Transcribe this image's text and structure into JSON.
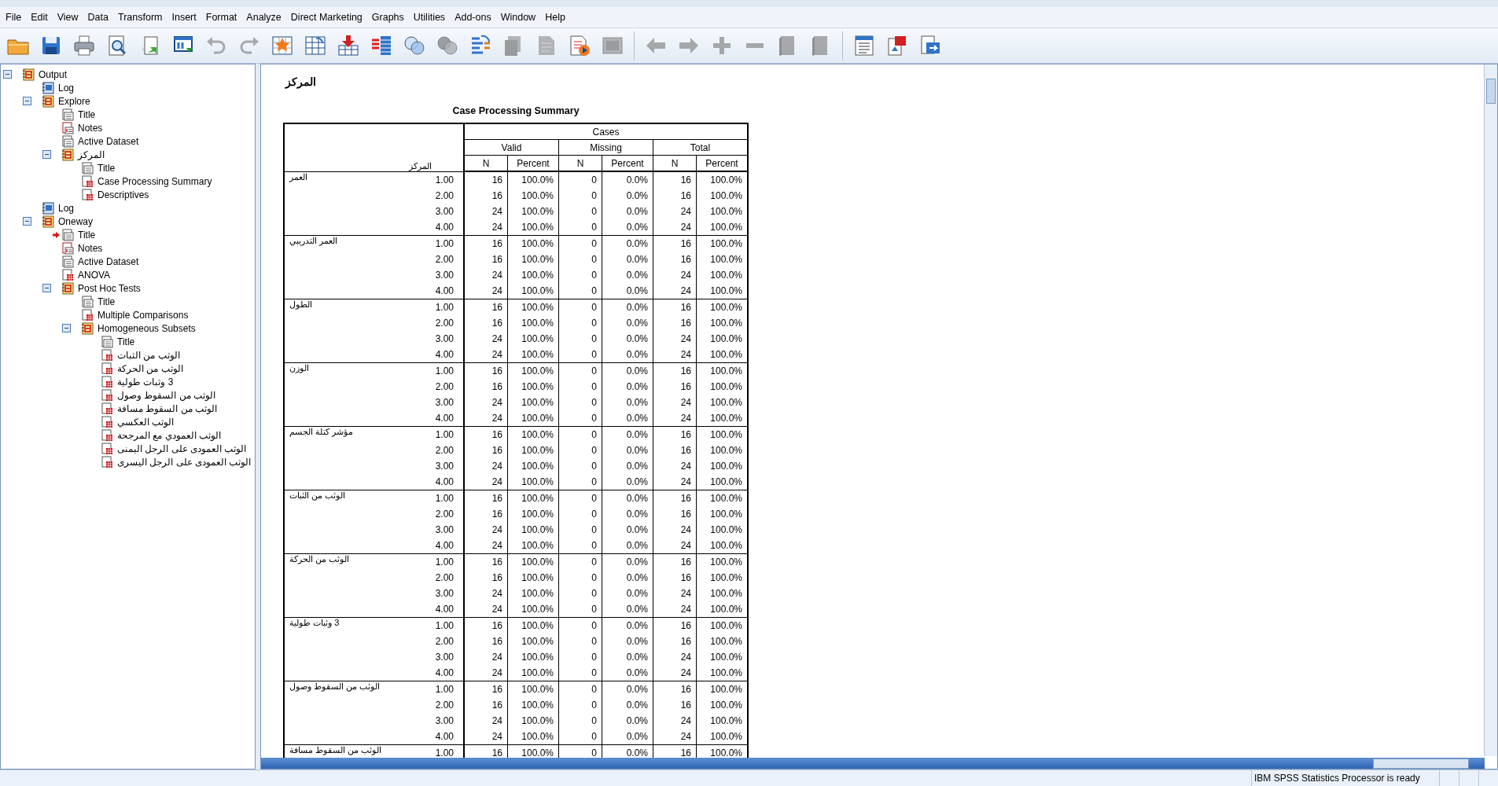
{
  "menu": [
    "File",
    "Edit",
    "View",
    "Data",
    "Transform",
    "Insert",
    "Format",
    "Analyze",
    "Direct Marketing",
    "Graphs",
    "Utilities",
    "Add-ons",
    "Window",
    "Help"
  ],
  "toolbar": [
    {
      "kind": "folder",
      "disabled": false
    },
    {
      "kind": "disk",
      "disabled": false
    },
    {
      "kind": "printer",
      "disabled": false
    },
    {
      "kind": "preview",
      "disabled": false
    },
    {
      "kind": "export",
      "disabled": false
    },
    {
      "kind": "window",
      "disabled": false
    },
    {
      "kind": "undo",
      "disabled": true
    },
    {
      "kind": "redo",
      "disabled": true
    },
    {
      "kind": "star-grid",
      "disabled": false
    },
    {
      "kind": "grid",
      "disabled": false
    },
    {
      "kind": "download",
      "disabled": false
    },
    {
      "kind": "bars",
      "disabled": false
    },
    {
      "kind": "circles",
      "disabled": false
    },
    {
      "kind": "circles",
      "disabled": true
    },
    {
      "kind": "list",
      "disabled": false
    },
    {
      "kind": "docs",
      "disabled": true
    },
    {
      "kind": "doc",
      "disabled": true
    },
    {
      "kind": "doc-play",
      "disabled": false
    },
    {
      "kind": "frame",
      "disabled": true
    },
    {
      "kind": "left",
      "disabled": true
    },
    {
      "kind": "right",
      "disabled": true
    },
    {
      "kind": "plus",
      "disabled": true
    },
    {
      "kind": "minus",
      "disabled": true
    },
    {
      "kind": "book",
      "disabled": true
    },
    {
      "kind": "book",
      "disabled": true
    },
    {
      "kind": "doc-lines",
      "disabled": false
    },
    {
      "kind": "doc-red",
      "disabled": false
    },
    {
      "kind": "doc-blue",
      "disabled": false
    }
  ],
  "tree": [
    {
      "label": "Output",
      "kind": "navigator",
      "expanded": true,
      "current": false,
      "children": [
        {
          "label": "Log",
          "kind": "log",
          "current": false
        },
        {
          "label": "Explore",
          "kind": "navigator",
          "expanded": true,
          "current": false,
          "children": [
            {
              "label": "Title",
              "kind": "title",
              "current": false
            },
            {
              "label": "Notes",
              "kind": "notes",
              "current": false
            },
            {
              "label": "Active Dataset",
              "kind": "dataset",
              "current": false
            },
            {
              "label": "المركز",
              "kind": "navigator",
              "expanded": true,
              "current": false,
              "children": [
                {
                  "label": "Title",
                  "kind": "title",
                  "current": false
                },
                {
                  "label": "Case Processing Summary",
                  "kind": "table",
                  "current": false
                },
                {
                  "label": "Descriptives",
                  "kind": "table",
                  "current": false
                }
              ]
            }
          ]
        },
        {
          "label": "Log",
          "kind": "log",
          "current": false
        },
        {
          "label": "Oneway",
          "kind": "navigator",
          "expanded": true,
          "current": false,
          "children": [
            {
              "label": "Title",
              "kind": "title",
              "current": true
            },
            {
              "label": "Notes",
              "kind": "notes",
              "current": false
            },
            {
              "label": "Active Dataset",
              "kind": "dataset",
              "current": false
            },
            {
              "label": "ANOVA",
              "kind": "table",
              "current": false
            },
            {
              "label": "Post Hoc Tests",
              "kind": "navigator",
              "expanded": true,
              "current": false,
              "children": [
                {
                  "label": "Title",
                  "kind": "title",
                  "current": false
                },
                {
                  "label": "Multiple Comparisons",
                  "kind": "table",
                  "current": false
                },
                {
                  "label": "Homogeneous Subsets",
                  "kind": "navigator",
                  "expanded": true,
                  "current": false,
                  "children": [
                    {
                      "label": "Title",
                      "kind": "title",
                      "current": false
                    },
                    {
                      "label": "الوثب من الثبات",
                      "kind": "table",
                      "current": false
                    },
                    {
                      "label": "الوثب من الحركة",
                      "kind": "table",
                      "current": false
                    },
                    {
                      "label": "3 وثبات طولية",
                      "kind": "table",
                      "current": false
                    },
                    {
                      "label": "الوثب من السقوط وصول",
                      "kind": "table",
                      "current": false
                    },
                    {
                      "label": "الوثب من السقوط مسافة",
                      "kind": "table",
                      "current": false
                    },
                    {
                      "label": "الوثب العكسي",
                      "kind": "table",
                      "current": false
                    },
                    {
                      "label": "الوثب العمودي مع المرجحة",
                      "kind": "table",
                      "current": false
                    },
                    {
                      "label": "الوثب العمودى على الرجل اليمنى",
                      "kind": "table",
                      "current": false
                    },
                    {
                      "label": "الوثب العمودى على الرجل اليسرى",
                      "kind": "table",
                      "current": false
                    }
                  ]
                }
              ]
            }
          ]
        }
      ]
    }
  ],
  "output": {
    "heading": "المركز",
    "table": {
      "title": "Case Processing Summary",
      "row_header": "المركز",
      "super_header": "Cases",
      "groups": [
        "Valid",
        "Missing",
        "Total"
      ],
      "columns": [
        "N",
        "Percent",
        "N",
        "Percent",
        "N",
        "Percent"
      ],
      "row_groups": [
        {
          "label": "العمر",
          "rows": [
            [
              "1.00",
              "16",
              "100.0%",
              "0",
              "0.0%",
              "16",
              "100.0%"
            ],
            [
              "2.00",
              "16",
              "100.0%",
              "0",
              "0.0%",
              "16",
              "100.0%"
            ],
            [
              "3.00",
              "24",
              "100.0%",
              "0",
              "0.0%",
              "24",
              "100.0%"
            ],
            [
              "4.00",
              "24",
              "100.0%",
              "0",
              "0.0%",
              "24",
              "100.0%"
            ]
          ]
        },
        {
          "label": "العمر التدريبي",
          "rows": [
            [
              "1.00",
              "16",
              "100.0%",
              "0",
              "0.0%",
              "16",
              "100.0%"
            ],
            [
              "2.00",
              "16",
              "100.0%",
              "0",
              "0.0%",
              "16",
              "100.0%"
            ],
            [
              "3.00",
              "24",
              "100.0%",
              "0",
              "0.0%",
              "24",
              "100.0%"
            ],
            [
              "4.00",
              "24",
              "100.0%",
              "0",
              "0.0%",
              "24",
              "100.0%"
            ]
          ]
        },
        {
          "label": "الطول",
          "rows": [
            [
              "1.00",
              "16",
              "100.0%",
              "0",
              "0.0%",
              "16",
              "100.0%"
            ],
            [
              "2.00",
              "16",
              "100.0%",
              "0",
              "0.0%",
              "16",
              "100.0%"
            ],
            [
              "3.00",
              "24",
              "100.0%",
              "0",
              "0.0%",
              "24",
              "100.0%"
            ],
            [
              "4.00",
              "24",
              "100.0%",
              "0",
              "0.0%",
              "24",
              "100.0%"
            ]
          ]
        },
        {
          "label": "الوزن",
          "rows": [
            [
              "1.00",
              "16",
              "100.0%",
              "0",
              "0.0%",
              "16",
              "100.0%"
            ],
            [
              "2.00",
              "16",
              "100.0%",
              "0",
              "0.0%",
              "16",
              "100.0%"
            ],
            [
              "3.00",
              "24",
              "100.0%",
              "0",
              "0.0%",
              "24",
              "100.0%"
            ],
            [
              "4.00",
              "24",
              "100.0%",
              "0",
              "0.0%",
              "24",
              "100.0%"
            ]
          ]
        },
        {
          "label": "مؤشر كتلة الجسم",
          "rows": [
            [
              "1.00",
              "16",
              "100.0%",
              "0",
              "0.0%",
              "16",
              "100.0%"
            ],
            [
              "2.00",
              "16",
              "100.0%",
              "0",
              "0.0%",
              "16",
              "100.0%"
            ],
            [
              "3.00",
              "24",
              "100.0%",
              "0",
              "0.0%",
              "24",
              "100.0%"
            ],
            [
              "4.00",
              "24",
              "100.0%",
              "0",
              "0.0%",
              "24",
              "100.0%"
            ]
          ]
        },
        {
          "label": "الوثب من الثبات",
          "rows": [
            [
              "1.00",
              "16",
              "100.0%",
              "0",
              "0.0%",
              "16",
              "100.0%"
            ],
            [
              "2.00",
              "16",
              "100.0%",
              "0",
              "0.0%",
              "16",
              "100.0%"
            ],
            [
              "3.00",
              "24",
              "100.0%",
              "0",
              "0.0%",
              "24",
              "100.0%"
            ],
            [
              "4.00",
              "24",
              "100.0%",
              "0",
              "0.0%",
              "24",
              "100.0%"
            ]
          ]
        },
        {
          "label": "الوثب من الحركة",
          "rows": [
            [
              "1.00",
              "16",
              "100.0%",
              "0",
              "0.0%",
              "16",
              "100.0%"
            ],
            [
              "2.00",
              "16",
              "100.0%",
              "0",
              "0.0%",
              "16",
              "100.0%"
            ],
            [
              "3.00",
              "24",
              "100.0%",
              "0",
              "0.0%",
              "24",
              "100.0%"
            ],
            [
              "4.00",
              "24",
              "100.0%",
              "0",
              "0.0%",
              "24",
              "100.0%"
            ]
          ]
        },
        {
          "label": "3 وثبات طولية",
          "rows": [
            [
              "1.00",
              "16",
              "100.0%",
              "0",
              "0.0%",
              "16",
              "100.0%"
            ],
            [
              "2.00",
              "16",
              "100.0%",
              "0",
              "0.0%",
              "16",
              "100.0%"
            ],
            [
              "3.00",
              "24",
              "100.0%",
              "0",
              "0.0%",
              "24",
              "100.0%"
            ],
            [
              "4.00",
              "24",
              "100.0%",
              "0",
              "0.0%",
              "24",
              "100.0%"
            ]
          ]
        },
        {
          "label": "الوثب من السقوط وصول",
          "rows": [
            [
              "1.00",
              "16",
              "100.0%",
              "0",
              "0.0%",
              "16",
              "100.0%"
            ],
            [
              "2.00",
              "16",
              "100.0%",
              "0",
              "0.0%",
              "16",
              "100.0%"
            ],
            [
              "3.00",
              "24",
              "100.0%",
              "0",
              "0.0%",
              "24",
              "100.0%"
            ],
            [
              "4.00",
              "24",
              "100.0%",
              "0",
              "0.0%",
              "24",
              "100.0%"
            ]
          ]
        },
        {
          "label": "الوثب من السقوط مسافة",
          "rows": [
            [
              "1.00",
              "16",
              "100.0%",
              "0",
              "0.0%",
              "16",
              "100.0%"
            ]
          ]
        }
      ]
    }
  },
  "status_bar": "IBM SPSS Statistics Processor is ready"
}
